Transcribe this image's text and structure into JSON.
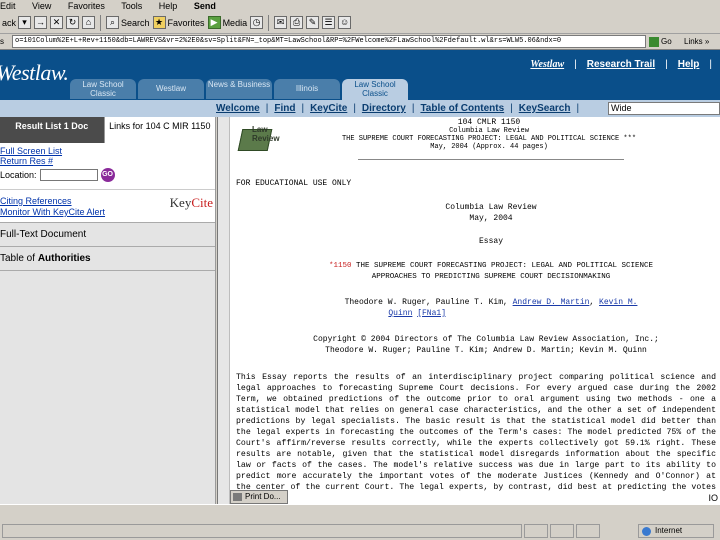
{
  "browser": {
    "menu": [
      "Edit",
      "View",
      "Favorites",
      "Tools",
      "Help",
      "Send"
    ],
    "toolbar": {
      "back": "ack",
      "search": "Search",
      "favorites": "Favorites",
      "media": "Media"
    },
    "address": {
      "url": "o=101Colum%2E+L+Rev+1150&db=LAWREVS&vr=2%2E0&sv=Split&FN=_top&MT=LawSchool&RP=%2FWelcome%2FLawSchool%2Fdefault.wl&rs=WLW5.06&ndx=0",
      "go": "Go",
      "links": "Links"
    },
    "status_zone": "Internet"
  },
  "westlaw": {
    "logo": "Westlaw.",
    "nav": {
      "brand": "Westlaw",
      "research_trail": "Research Trail",
      "help": "Help",
      "sep": "|"
    },
    "tabs": [
      "Law School Classic",
      "Westlaw",
      "News & Business",
      "Illinois",
      "Law School Classic"
    ],
    "subnav": [
      "Welcome",
      "Find",
      "KeyCite",
      "Directory",
      "Table of Contents",
      "KeySearch"
    ],
    "subnav_search_value": "Wide"
  },
  "left_panel": {
    "tab_result_list": "Result List 1 Doc",
    "tab_links": "Links for 104 C MIR 1150",
    "links": [
      "Full Screen List",
      "Return Res #"
    ],
    "location_label": "Location:",
    "go_label": "GO",
    "keycite_links": [
      "Citing References",
      "Monitor With KeyCite Alert"
    ],
    "keycite_logo_key": "Key",
    "keycite_logo_cite": "Cite",
    "items": [
      {
        "prefix": "",
        "label": "Full-Text Document"
      },
      {
        "prefix": "Table of ",
        "label": "Authorities"
      }
    ]
  },
  "document": {
    "icon_label": "Law Review",
    "cite": "104 CMLR 1150",
    "journal": "Columbia Law Review",
    "project": "THE SUPREME COURT FORECASTING PROJECT: LEGAL AND POLITICAL SCIENCE ***",
    "date_pages": "May, 2004 (Approx. 44 pages)",
    "edu_notice": "FOR EDUCATIONAL USE ONLY",
    "journal_center": "Columbia Law Review",
    "date_center": "May, 2004",
    "type": "Essay",
    "star_page": "*1150",
    "title_rest": "THE SUPREME COURT FORECASTING PROJECT: LEGAL AND POLITICAL SCIENCE",
    "title_line2": "APPROACHES TO PREDICTING SUPREME COURT DECISIONMAKING",
    "authors_plain": "Theodore W. Ruger, Pauline T. Kim,",
    "author_link1": "Andrew D. Martin",
    "author_link2": "Kevin M.",
    "author_link2b": "Quinn",
    "fn_link": "[FNa1]",
    "copyright": "Copyright © 2004 Directors of The Columbia Law Review Association, Inc.;",
    "copyright2": "Theodore W. Ruger; Pauline T. Kim; Andrew D. Martin; Kevin M. Quinn",
    "body": "This Essay reports the results of an interdisciplinary project comparing political science and legal approaches to forecasting Supreme Court decisions. For every argued case during the 2002 Term, we obtained predictions of the outcome prior to oral argument using two methods - one a statistical model that relies on general case characteristics, and the other a set of independent predictions by legal specialists. The basic result is that the statistical model did better than the legal experts in forecasting the outcomes of the Term's cases: The model predicted 75% of the Court's affirm/reverse results correctly, while the experts collectively got 59.1% right. These results are notable, given that the statistical model disregards information about the specific law or facts of the cases. The model's relative success was due in large part to its ability to predict more accurately the important votes of the moderate Justices (Kennedy and O'Connor) at the center of the current Court. The legal experts, by contrast, did best at predicting the votes of",
    "print_button": "Print Do...",
    "foot_right": "IO"
  }
}
